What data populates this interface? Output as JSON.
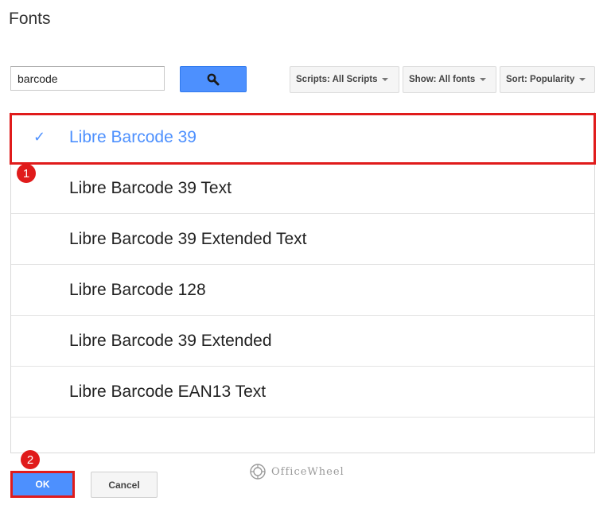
{
  "dialog": {
    "title": "Fonts"
  },
  "search": {
    "value": "barcode",
    "button_icon": "search-icon"
  },
  "filters": {
    "scripts": "Scripts: All Scripts",
    "show": "Show: All fonts",
    "sort": "Sort: Popularity"
  },
  "fonts": [
    {
      "name": "Libre Barcode 39",
      "selected": true
    },
    {
      "name": "Libre Barcode 39 Text",
      "selected": false
    },
    {
      "name": "Libre Barcode 39 Extended Text",
      "selected": false
    },
    {
      "name": "Libre Barcode 128",
      "selected": false
    },
    {
      "name": "Libre Barcode 39 Extended",
      "selected": false
    },
    {
      "name": "Libre Barcode EAN13 Text",
      "selected": false
    }
  ],
  "selected_mark": "✓",
  "annotations": {
    "step1": "1",
    "step2": "2"
  },
  "buttons": {
    "ok": "OK",
    "cancel": "Cancel"
  },
  "watermark": {
    "text": "OfficeWheel"
  },
  "colors": {
    "accent": "#4d90fe",
    "highlight": "#e01b1b"
  }
}
